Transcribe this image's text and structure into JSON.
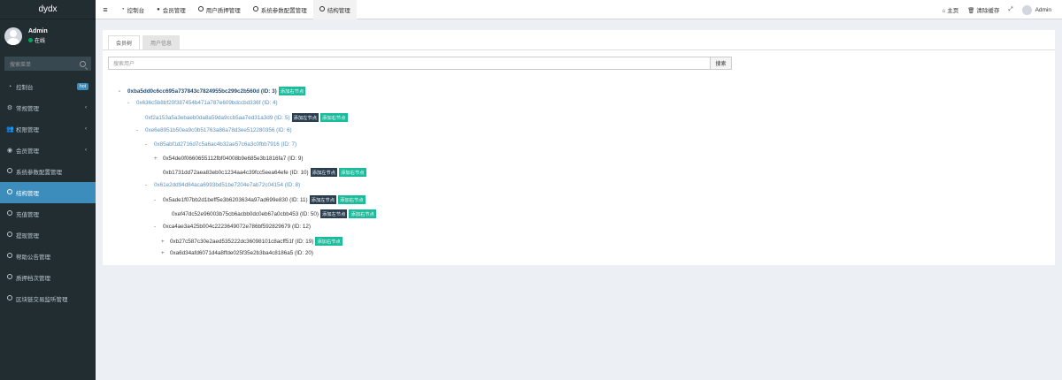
{
  "app": {
    "logo": "dydx",
    "user_name": "Admin",
    "user_status": "在线",
    "sidebar_search_placeholder": "搜索菜单"
  },
  "sidebar": {
    "items": [
      {
        "label": "控制台",
        "badge": "hot"
      },
      {
        "label": "常规管理"
      },
      {
        "label": "权限管理"
      },
      {
        "label": "会员管理"
      },
      {
        "label": "系统参数配置管理"
      },
      {
        "label": "结构管理"
      },
      {
        "label": "充值管理"
      },
      {
        "label": "提现管理"
      },
      {
        "label": "帮助公告管理"
      },
      {
        "label": "质押档次管理"
      },
      {
        "label": "区块链交易监听管理"
      }
    ]
  },
  "header": {
    "tabs": [
      "控制台",
      "会员管理",
      "用户质押管理",
      "系统参数配置管理",
      "结构管理"
    ],
    "home": "主页",
    "clear_cache": "清除缓存",
    "admin": "Admin"
  },
  "panel": {
    "tab_active": "会员树",
    "tab_inactive": "用户信息",
    "search_placeholder": "搜索用户",
    "search_button": "搜索"
  },
  "buttons": {
    "add_left": "添加左节点",
    "add_right": "添加右节点"
  },
  "tree": [
    {
      "sym": "-",
      "text": "0xba5dd0c6cc695a737843c7824955bc299c2b560d (ID: 3)",
      "style": "bold",
      "buttons": [
        "right"
      ]
    },
    {
      "sym": "-",
      "text": "0x636c5b8bf20f387454b471a787e609bdccbd336f (ID: 4)",
      "style": "muted",
      "buttons": []
    },
    {
      "sym": "",
      "text": "0xf2a153a5a3ebaeb0da8a59da9ccb5aa7ed31a3d9 (ID: 5)",
      "style": "muted",
      "buttons": [
        "left",
        "right"
      ]
    },
    {
      "sym": "-",
      "text": "0xe6e8951b50ea9c0b51763a86a78d3ee512280356 (ID: 6)",
      "style": "muted",
      "buttons": []
    },
    {
      "sym": "-",
      "text": "0x85abf1d2716d7c5a6ac4b32ae57c6a3c0fbb7916 (ID: 7)",
      "style": "muted",
      "buttons": []
    },
    {
      "sym": "+",
      "text": "0x54de0f0660655112fbf04008b9e685e3b1816fa7 (ID: 9)",
      "style": "plain",
      "buttons": []
    },
    {
      "sym": "",
      "text": "0xb1731dd72aea83eb0c1234aa4c39fcc5eea64efe (ID: 10)",
      "style": "plain",
      "buttons": [
        "left",
        "right"
      ]
    },
    {
      "sym": "-",
      "text": "0x61e2dd94d84aca6993bd51be7204e7ab72c04154 (ID: 8)",
      "style": "muted",
      "buttons": []
    },
    {
      "sym": "-",
      "text": "0x5ade1f07bb2d1beff5e3b6203634a97ad699e830 (ID: 11)",
      "style": "plain",
      "buttons": [
        "left",
        "right"
      ]
    },
    {
      "sym": "",
      "text": "0xef47dc52e96003b75cb6acbb0dc0eb67a0cbb453 (ID: 50)",
      "style": "plain",
      "buttons": [
        "left",
        "right"
      ]
    },
    {
      "sym": "-",
      "text": "0xca4ae3a425b004c2223649072e786bf592829679 (ID: 12)",
      "style": "plain",
      "buttons": []
    },
    {
      "sym": "+",
      "text": "0xb27c587c30e2aed535222dc36098101c8acff51f (ID: 19)",
      "style": "plain",
      "buttons": [
        "right"
      ]
    },
    {
      "sym": "+",
      "text": "0xa6d34afd6071d4a8ffde025f35e2b3ba4c8186a5 (ID: 20)",
      "style": "plain",
      "buttons": []
    }
  ],
  "watermark": "https://www.huzhan.com/ishop50151"
}
